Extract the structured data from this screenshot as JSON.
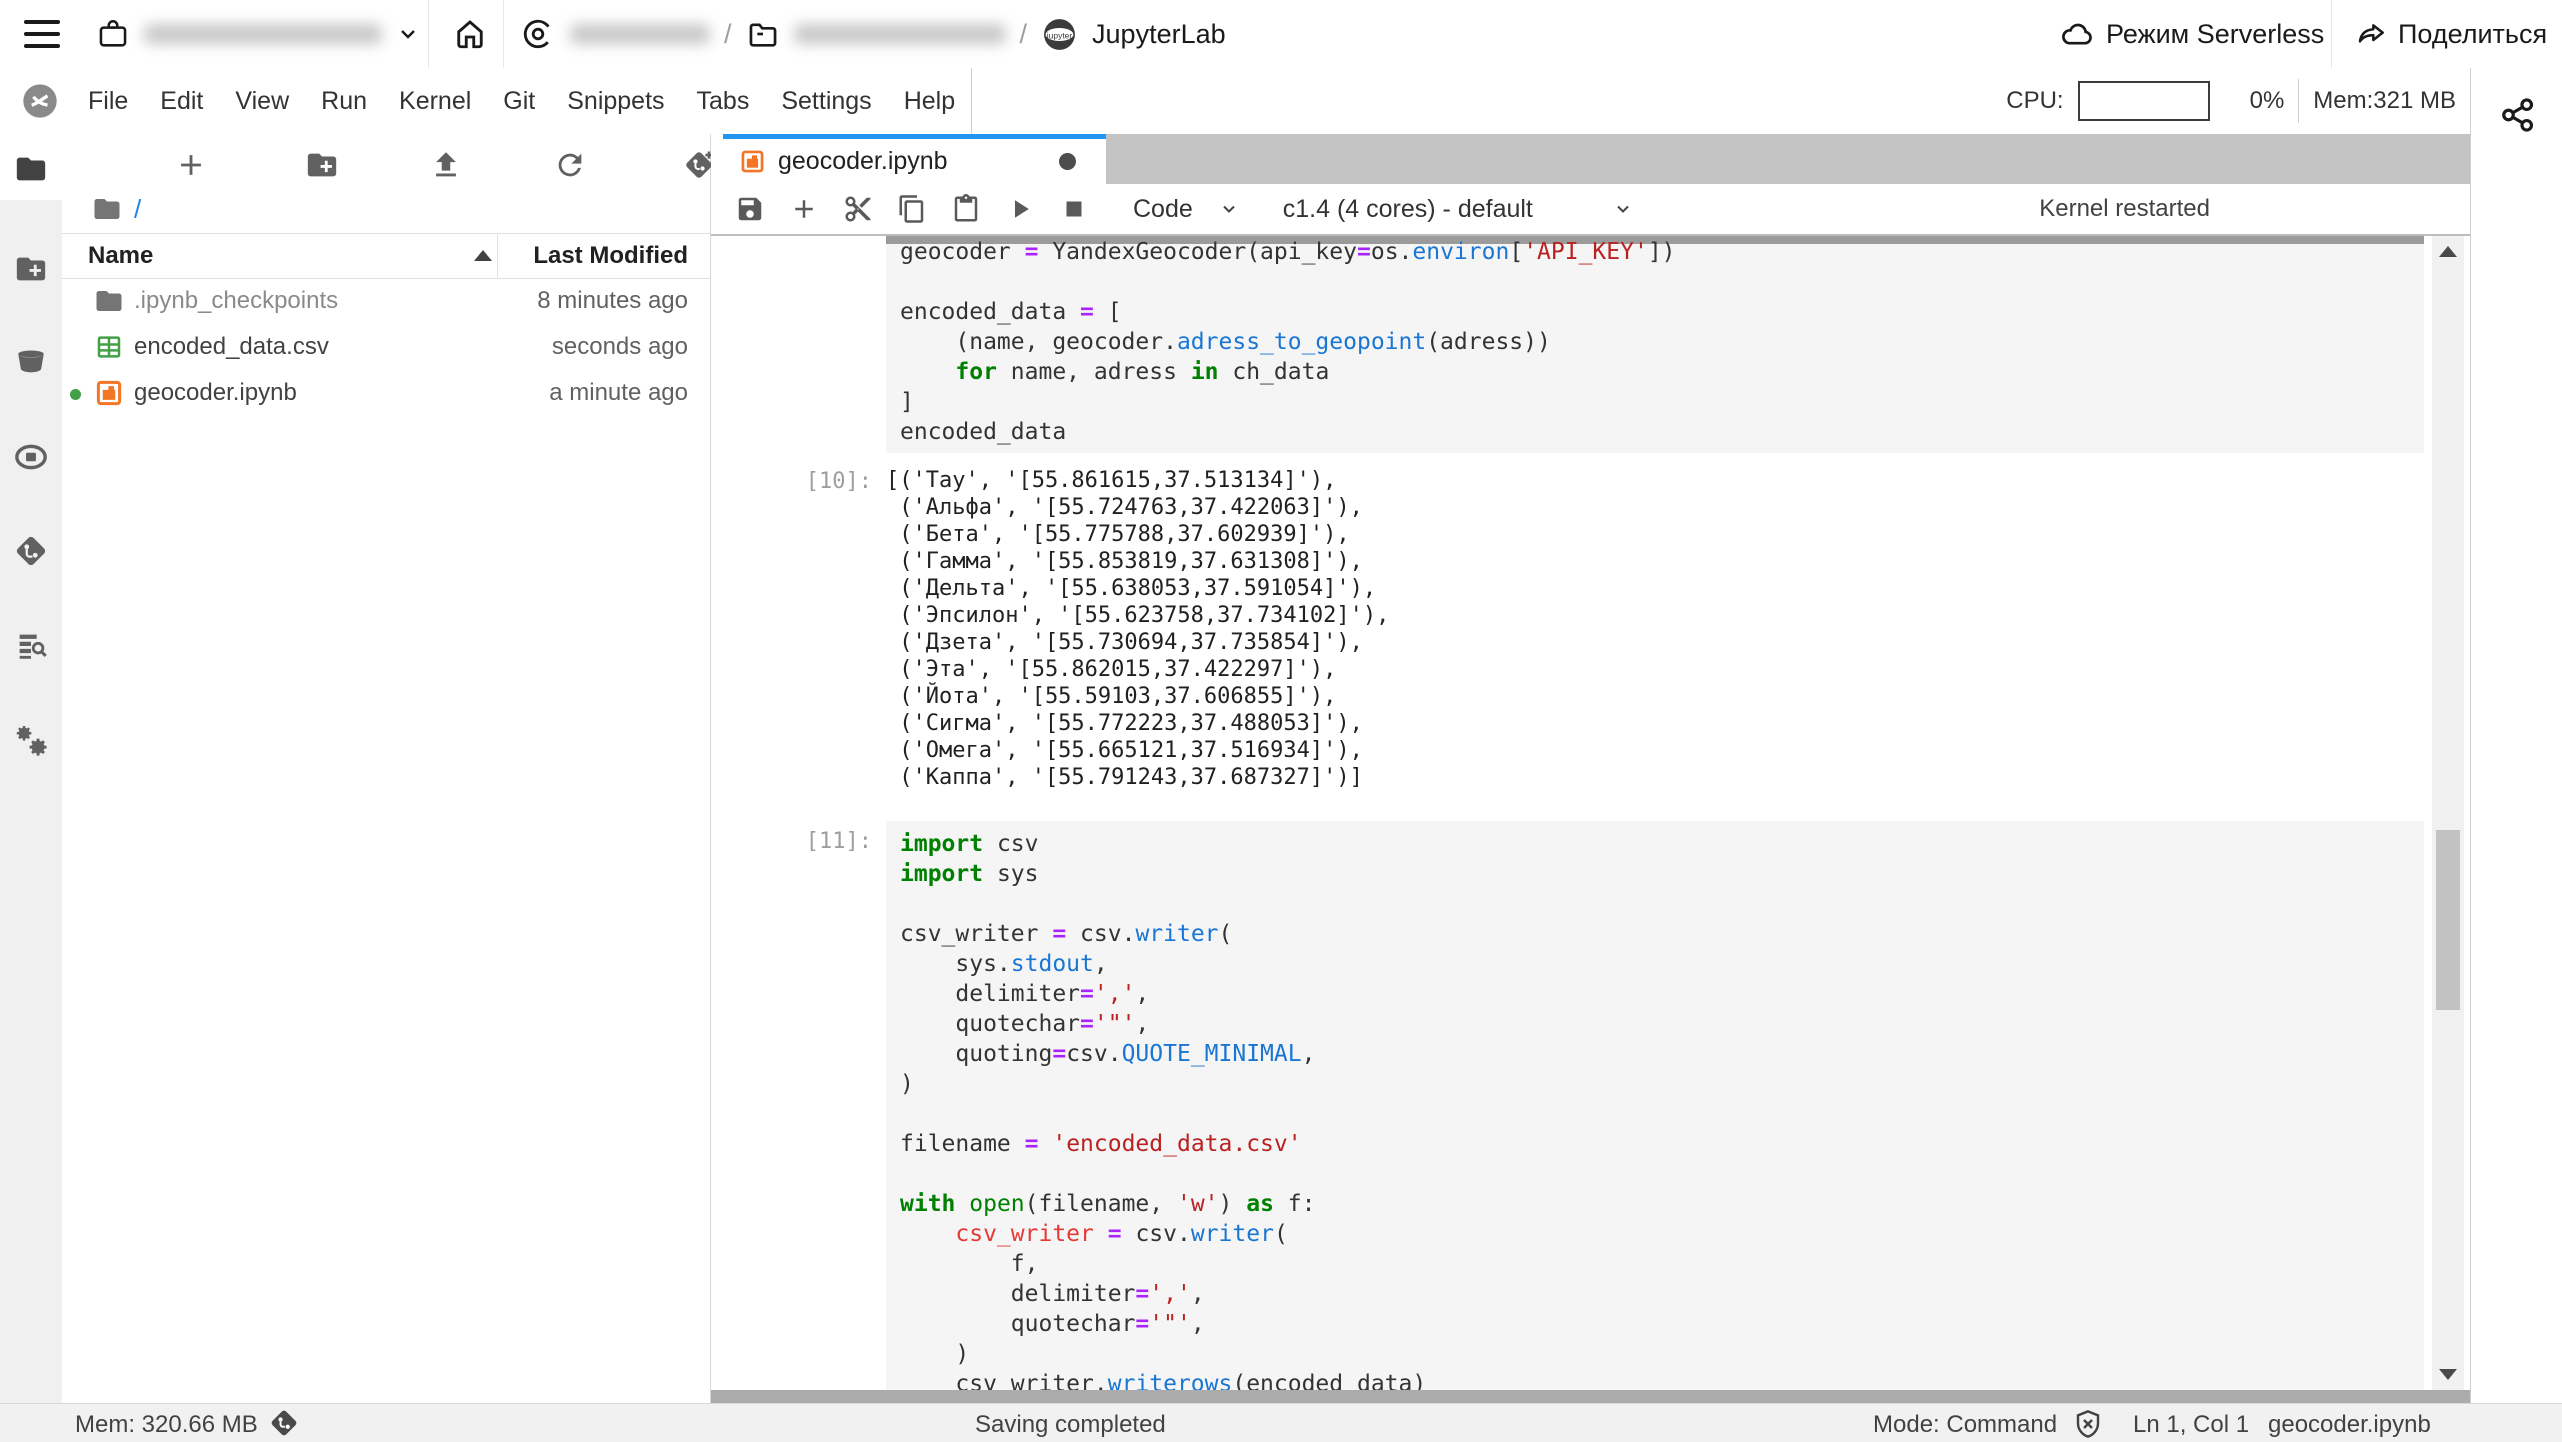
{
  "topbar": {
    "app_title": "JupyterLab",
    "breadcrumb_sep": "/",
    "serverless_label": "Режим Serverless",
    "share_label": "Поделиться"
  },
  "menubar": {
    "items": [
      "File",
      "Edit",
      "View",
      "Run",
      "Kernel",
      "Git",
      "Snippets",
      "Tabs",
      "Settings",
      "Help"
    ],
    "cpu_label": "CPU:",
    "cpu_percent": "0%",
    "mem_label": "Mem:321 MB"
  },
  "filebrowser": {
    "path_root": "/",
    "header": {
      "name": "Name",
      "modified": "Last Modified"
    },
    "files": [
      {
        "name": ".ipynb_checkpoints",
        "modified": "8 minutes ago"
      },
      {
        "name": "encoded_data.csv",
        "modified": "seconds ago"
      },
      {
        "name": "geocoder.ipynb",
        "modified": "a minute ago"
      }
    ]
  },
  "notebook": {
    "tab_title": "geocoder.ipynb",
    "cell_type": "Code",
    "kernel_name": "c1.4 (4 cores) - default",
    "kernel_status": "Kernel restarted",
    "cells": {
      "cell_top": {
        "prompt": "",
        "lines": [
          [
            [
              "var",
              "geocoder "
            ],
            [
              "op",
              "="
            ],
            [
              "var",
              " YandexGeocoder(api_key"
            ],
            [
              "op",
              "="
            ],
            [
              "var",
              "os."
            ],
            [
              "fn",
              "environ"
            ],
            [
              "var",
              "["
            ],
            [
              "str",
              "'API_KEY'"
            ],
            [
              "var",
              "])"
            ]
          ],
          [],
          [
            [
              "var",
              "encoded_data "
            ],
            [
              "op",
              "="
            ],
            [
              "var",
              " ["
            ]
          ],
          [
            [
              "var",
              "    (name, geocoder."
            ],
            [
              "fn",
              "adress_to_geopoint"
            ],
            [
              "var",
              "(adress))"
            ]
          ],
          [
            [
              "var",
              "    "
            ],
            [
              "kw",
              "for"
            ],
            [
              "var",
              " name, adress "
            ],
            [
              "kw",
              "in"
            ],
            [
              "var",
              " ch_data"
            ]
          ],
          [
            [
              "var",
              "]"
            ]
          ],
          [
            [
              "var",
              "encoded_data"
            ]
          ]
        ]
      },
      "out10": {
        "prompt": "[10]:",
        "lines": [
          "[('Тау', '[55.861615,37.513134]'),",
          " ('Альфа', '[55.724763,37.422063]'),",
          " ('Бета', '[55.775788,37.602939]'),",
          " ('Гамма', '[55.853819,37.631308]'),",
          " ('Дельта', '[55.638053,37.591054]'),",
          " ('Эпсилон', '[55.623758,37.734102]'),",
          " ('Дзета', '[55.730694,37.735854]'),",
          " ('Эта', '[55.862015,37.422297]'),",
          " ('Йота', '[55.59103,37.606855]'),",
          " ('Сигма', '[55.772223,37.488053]'),",
          " ('Омега', '[55.665121,37.516934]'),",
          " ('Каппа', '[55.791243,37.687327]')]"
        ]
      },
      "cell11": {
        "prompt": "[11]:",
        "lines": [
          [
            [
              "kw",
              "import"
            ],
            [
              "var",
              " csv"
            ]
          ],
          [
            [
              "kw",
              "import"
            ],
            [
              "var",
              " sys"
            ]
          ],
          [],
          [
            [
              "var",
              "csv_writer "
            ],
            [
              "op",
              "="
            ],
            [
              "var",
              " csv."
            ],
            [
              "fn",
              "writer"
            ],
            [
              "var",
              "("
            ]
          ],
          [
            [
              "var",
              "    sys."
            ],
            [
              "fn",
              "stdout"
            ],
            [
              "var",
              ","
            ]
          ],
          [
            [
              "var",
              "    delimiter"
            ],
            [
              "op",
              "="
            ],
            [
              "str",
              "','"
            ],
            [
              "var",
              ","
            ]
          ],
          [
            [
              "var",
              "    quotechar"
            ],
            [
              "op",
              "="
            ],
            [
              "str",
              "'\"'"
            ],
            [
              "var",
              ","
            ]
          ],
          [
            [
              "var",
              "    quoting"
            ],
            [
              "op",
              "="
            ],
            [
              "var",
              "csv."
            ],
            [
              "fn",
              "QUOTE_MINIMAL"
            ],
            [
              "var",
              ","
            ]
          ],
          [
            [
              "var",
              ")"
            ]
          ],
          [],
          [
            [
              "var",
              "filename "
            ],
            [
              "op",
              "="
            ],
            [
              "var",
              " "
            ],
            [
              "str",
              "'encoded_data.csv'"
            ]
          ],
          [],
          [
            [
              "kw",
              "with"
            ],
            [
              "var",
              " "
            ],
            [
              "kw2",
              "open"
            ],
            [
              "var",
              "(filename, "
            ],
            [
              "str",
              "'w'"
            ],
            [
              "var",
              ") "
            ],
            [
              "kw",
              "as"
            ],
            [
              "var",
              " f:"
            ]
          ],
          [
            [
              "var",
              "    "
            ],
            [
              "red",
              "csv_writer"
            ],
            [
              "var",
              " "
            ],
            [
              "op",
              "="
            ],
            [
              "var",
              " csv."
            ],
            [
              "fn",
              "writer"
            ],
            [
              "var",
              "("
            ]
          ],
          [
            [
              "var",
              "        f,"
            ]
          ],
          [
            [
              "var",
              "        delimiter"
            ],
            [
              "op",
              "="
            ],
            [
              "str",
              "','"
            ],
            [
              "var",
              ","
            ]
          ],
          [
            [
              "var",
              "        quotechar"
            ],
            [
              "op",
              "="
            ],
            [
              "str",
              "'\"'"
            ],
            [
              "var",
              ","
            ]
          ],
          [
            [
              "var",
              "    )"
            ]
          ],
          [
            [
              "var",
              "    csv_writer."
            ],
            [
              "fn",
              "writerows"
            ],
            [
              "var",
              "(encoded_data)"
            ]
          ]
        ]
      }
    }
  },
  "statusbar": {
    "mem": "Mem: 320.66 MB",
    "saving": "Saving completed",
    "mode": "Mode: Command",
    "position": "Ln 1, Col 1",
    "filename": "geocoder.ipynb"
  }
}
